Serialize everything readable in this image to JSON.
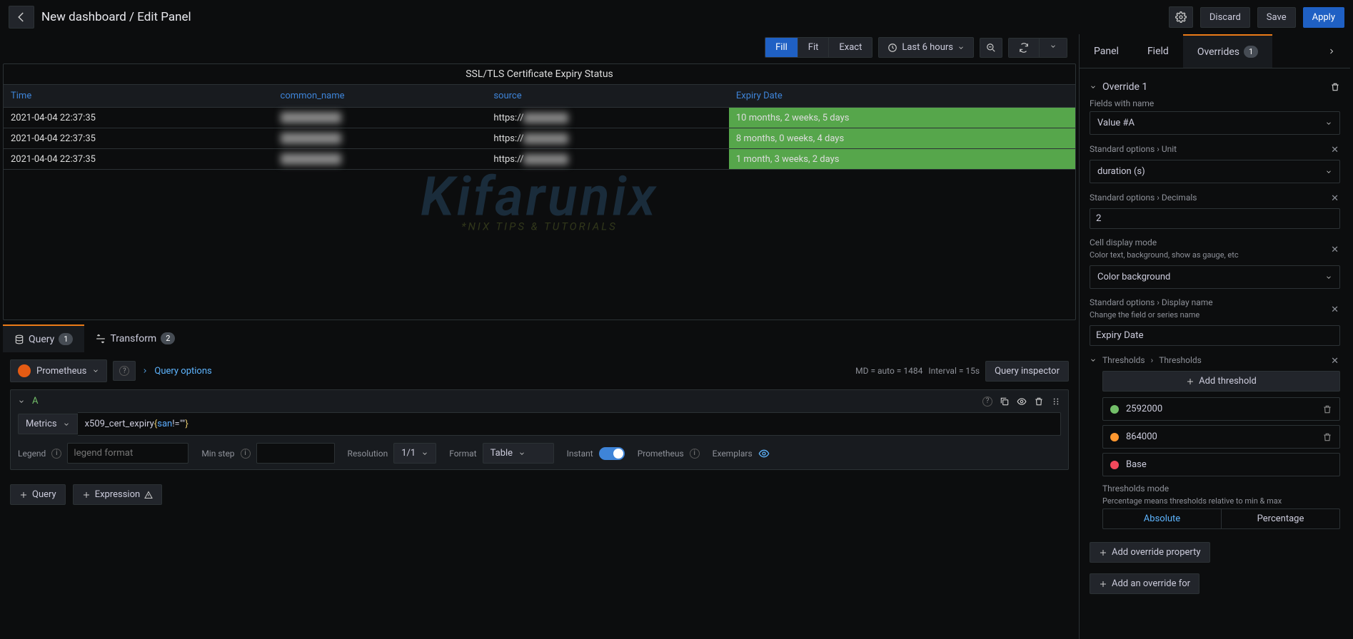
{
  "header": {
    "title": "New dashboard / Edit Panel",
    "discard": "Discard",
    "save": "Save",
    "apply": "Apply"
  },
  "toolbar": {
    "fill": "Fill",
    "fit": "Fit",
    "exact": "Exact",
    "timerange": "Last 6 hours"
  },
  "side_tabs": {
    "panel": "Panel",
    "field": "Field",
    "overrides": "Overrides",
    "overrides_count": "1"
  },
  "panel": {
    "title": "SSL/TLS Certificate Expiry Status",
    "columns": {
      "time": "Time",
      "common_name": "common_name",
      "source": "source",
      "expiry": "Expiry Date"
    },
    "rows": [
      {
        "time": "2021-04-04 22:37:35",
        "cn": "████████",
        "source": "https://████████",
        "expiry": "10 months, 2 weeks, 5 days"
      },
      {
        "time": "2021-04-04 22:37:35",
        "cn": "████████",
        "source": "https://████████",
        "expiry": "8 months, 0 weeks, 4 days"
      },
      {
        "time": "2021-04-04 22:37:35",
        "cn": "████████",
        "source": "https://████████",
        "expiry": "1 month, 3 weeks, 2 days"
      }
    ],
    "watermark": {
      "big": "Kifarunix",
      "sub": "*NIX TIPS & TUTORIALS"
    }
  },
  "bottom_tabs": {
    "query": "Query",
    "query_count": "1",
    "transform": "Transform",
    "transform_count": "2"
  },
  "query_bar": {
    "datasource": "Prometheus",
    "options": "Query options",
    "md": "MD = auto = 1484",
    "interval": "Interval = 15s",
    "inspector": "Query inspector"
  },
  "query_a": {
    "name": "A",
    "metrics_label": "Metrics",
    "expr_pre": "x509_cert_expiry",
    "expr_key": "san",
    "expr_rest": "!=\"\"",
    "legend": "Legend",
    "legend_placeholder": "legend format",
    "minstep": "Min step",
    "resolution": "Resolution",
    "resolution_val": "1/1",
    "format": "Format",
    "format_val": "Table",
    "instant": "Instant",
    "prometheus": "Prometheus",
    "exemplars": "Exemplars"
  },
  "add": {
    "query": "Query",
    "expression": "Expression"
  },
  "overrides": {
    "title": "Override 1",
    "fields_with_name": "Fields with name",
    "field_value": "Value #A",
    "std": "Standard options",
    "unit": "Unit",
    "unit_val": "duration (s)",
    "decimals": "Decimals",
    "decimals_val": "2",
    "cell_mode": "Cell display mode",
    "cell_mode_help": "Color text, background, show as gauge, etc",
    "cell_mode_val": "Color background",
    "display_name": "Display name",
    "display_name_help": "Change the field or series name",
    "display_name_val": "Expiry Date",
    "thresholds": "Thresholds",
    "add_threshold": "Add threshold",
    "t1": "2592000",
    "t2": "864000",
    "base": "Base",
    "mode": "Thresholds mode",
    "mode_help": "Percentage means thresholds relative to min & max",
    "absolute": "Absolute",
    "percentage": "Percentage",
    "add_prop": "Add override property",
    "add_override": "Add an override for"
  }
}
